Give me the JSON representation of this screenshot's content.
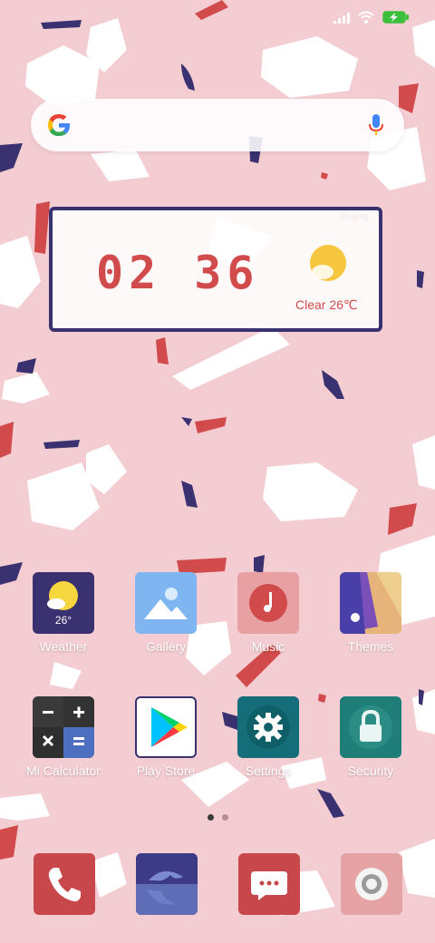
{
  "status_bar": {
    "icons": [
      "signal-icon",
      "wifi-icon",
      "battery-charging-icon"
    ],
    "battery_color": "#3cc03c"
  },
  "search": {
    "logo": "google-logo",
    "mic_icon": "microphone-icon"
  },
  "clock_widget": {
    "city": "Beijing",
    "time": "02 36",
    "condition_text": "Clear  26℃",
    "weather_icon": "sun-icon",
    "accent_color": "#d24b4c",
    "frame_color": "#3a3170"
  },
  "apps": [
    {
      "label": "Weather",
      "icon": "weather-icon",
      "badge": "26°"
    },
    {
      "label": "Gallery",
      "icon": "gallery-icon"
    },
    {
      "label": "Music",
      "icon": "music-icon"
    },
    {
      "label": "Themes",
      "icon": "themes-icon"
    },
    {
      "label": "Mi Calculator",
      "icon": "calculator-icon"
    },
    {
      "label": "Play Store",
      "icon": "play-store-icon"
    },
    {
      "label": "Settings",
      "icon": "settings-icon"
    },
    {
      "label": "Security",
      "icon": "security-icon"
    }
  ],
  "page_indicator": {
    "pages": 2,
    "active": 1
  },
  "dock": [
    {
      "icon": "phone-icon"
    },
    {
      "icon": "browser-icon"
    },
    {
      "icon": "messages-icon"
    },
    {
      "icon": "camera-icon"
    }
  ]
}
